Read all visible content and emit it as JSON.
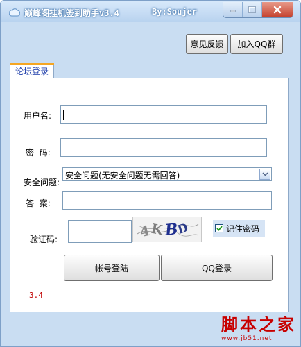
{
  "window": {
    "title": "巅峰阁挂机签到助手v3.4",
    "author": "By:Soujer",
    "controls": {
      "minimize_icon": "minimize-icon",
      "maximize_icon": "maximize-icon",
      "close_icon": "close-icon"
    },
    "accent_color": "#b9d3ef"
  },
  "toolbar": {
    "feedback_label": "意见反馈",
    "join_qq_group_label": "加入QQ群"
  },
  "tab": {
    "label": "论坛登录"
  },
  "form": {
    "username_label": "用户名:",
    "username_value": "",
    "password_label": "密  码:",
    "password_value": "",
    "security_question_label": "安全问题:",
    "security_question_selected": "安全问题(无安全问题无需回答)",
    "answer_label": "答  案:",
    "answer_value": "",
    "captcha_label": "验证码:",
    "captcha_value": "",
    "captcha_text": "4K BD",
    "remember_label": "记住密码",
    "remember_checked": true
  },
  "buttons": {
    "account_login_label": "帐号登陆",
    "qq_login_label": "QQ登录"
  },
  "version_text": "3.4",
  "watermark": {
    "text": "脚本之家",
    "url": "www.jb51.net",
    "color": "#c80000"
  }
}
